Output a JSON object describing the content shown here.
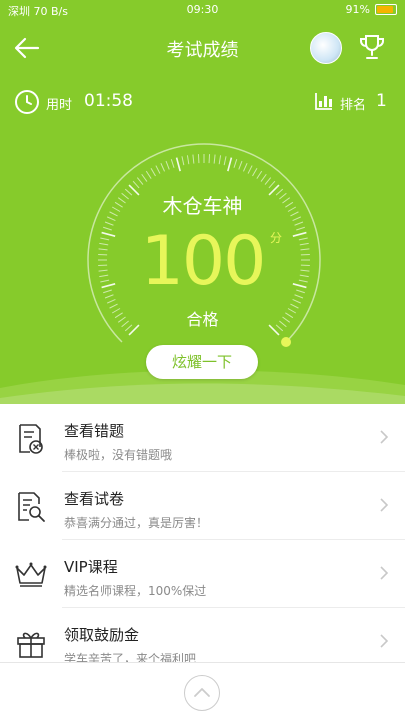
{
  "status_bar": {
    "left": "深圳 70 B/s",
    "time": "09:30",
    "battery": "91%"
  },
  "nav": {
    "title": "考试成绩",
    "back_icon": "arrow-left-icon",
    "avatar_icon": "avatar",
    "trophy_icon": "trophy-icon"
  },
  "summary": {
    "time_label": "用时",
    "time_value": "01:58",
    "rank_label": "排名",
    "rank_value": "1"
  },
  "result": {
    "name": "木仓车神",
    "score": "100",
    "unit": "分",
    "status": "合格",
    "score_fraction": 1.0
  },
  "share_button": "炫耀一下",
  "menu": [
    {
      "title": "查看错题",
      "subtitle": "棒极啦，没有错题哦",
      "icon": "wrong-questions-icon"
    },
    {
      "title": "查看试卷",
      "subtitle": "恭喜满分通过，真是厉害！",
      "icon": "view-paper-icon"
    },
    {
      "title": "VIP课程",
      "subtitle": "精选名师课程，100%保过",
      "icon": "crown-icon"
    },
    {
      "title": "领取鼓励金",
      "subtitle": "学车辛苦了，来个福利吧",
      "icon": "gift-icon"
    }
  ],
  "colors": {
    "primary": "#86cb2b",
    "score": "#e7f65a",
    "accent_text": "#7ec12a"
  },
  "bottom_icon": "chevron-up-icon"
}
